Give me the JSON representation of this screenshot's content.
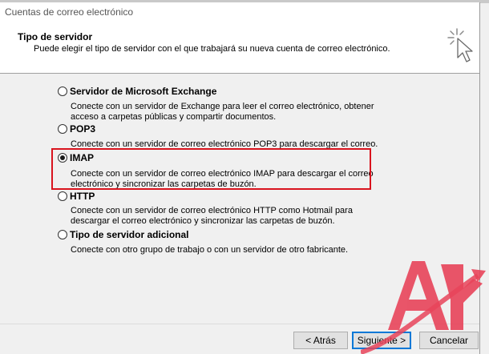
{
  "window": {
    "title": "Cuentas de correo electrónico"
  },
  "header": {
    "title": "Tipo de servidor",
    "subtitle": "Puede elegir el tipo de servidor con el que trabajará su nueva cuenta de correo electrónico."
  },
  "options": [
    {
      "label": "Servidor de Microsoft Exchange",
      "checked": false,
      "desc_lines": [
        "Conecte con un servidor de Exchange para leer el correo electrónico, obtener",
        "acceso a carpetas públicas y compartir documentos."
      ]
    },
    {
      "label": "POP3",
      "checked": false,
      "desc_lines": [
        "Conecte con un servidor de correo electrónico POP3 para descargar el correo."
      ]
    },
    {
      "label": "IMAP",
      "checked": true,
      "desc_lines": [
        "Conecte con un servidor de correo electrónico IMAP para descargar el correo",
        "electrónico y sincronizar las carpetas de buzón."
      ]
    },
    {
      "label": "HTTP",
      "checked": false,
      "desc_lines": [
        "Conecte con un servidor de correo electrónico HTTP como Hotmail para",
        "descargar el correo electrónico y sincronizar las carpetas de buzón."
      ]
    },
    {
      "label": "Tipo de servidor adicional",
      "checked": false,
      "desc_lines": [
        "Conecte con otro grupo de trabajo o con un servidor de otro fabricante."
      ]
    }
  ],
  "buttons": {
    "back": "< Atrás",
    "next": "Siguiente >",
    "cancel": "Cancelar"
  },
  "colors": {
    "highlight": "#d9141e",
    "watermark": "#e8445a"
  },
  "icons": {
    "wizard": "wizard-cursor-sparkle-icon",
    "watermark": "red-watermark-logo"
  }
}
